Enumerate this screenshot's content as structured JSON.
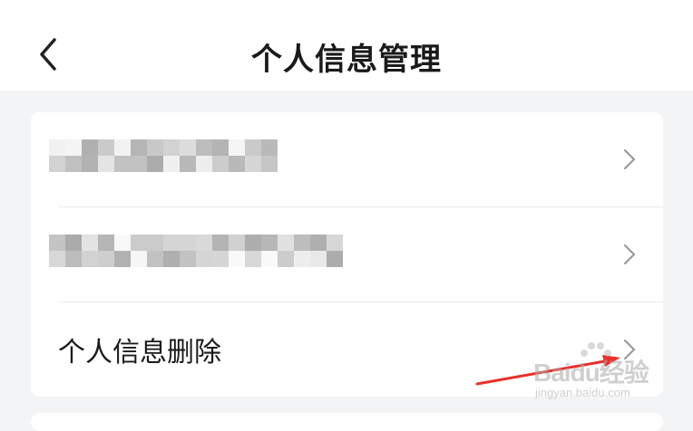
{
  "header": {
    "title": "个人信息管理",
    "back_icon": "chevron-left-icon"
  },
  "list": {
    "items": [
      {
        "label": "",
        "redacted": true,
        "chevron_icon": "chevron-right-icon"
      },
      {
        "label": "",
        "redacted": true,
        "chevron_icon": "chevron-right-icon"
      },
      {
        "label": "个人信息删除",
        "redacted": false,
        "chevron_icon": "chevron-right-icon"
      }
    ]
  },
  "annotation": {
    "arrow_color": "#e8302a"
  },
  "watermark": {
    "brand": "Baidu经验",
    "url": "jingyan.baidu.com"
  },
  "colors": {
    "background": "#f3f4f6",
    "card": "#ffffff",
    "text": "#1a1a1a",
    "chevron": "#9a9a9a"
  }
}
